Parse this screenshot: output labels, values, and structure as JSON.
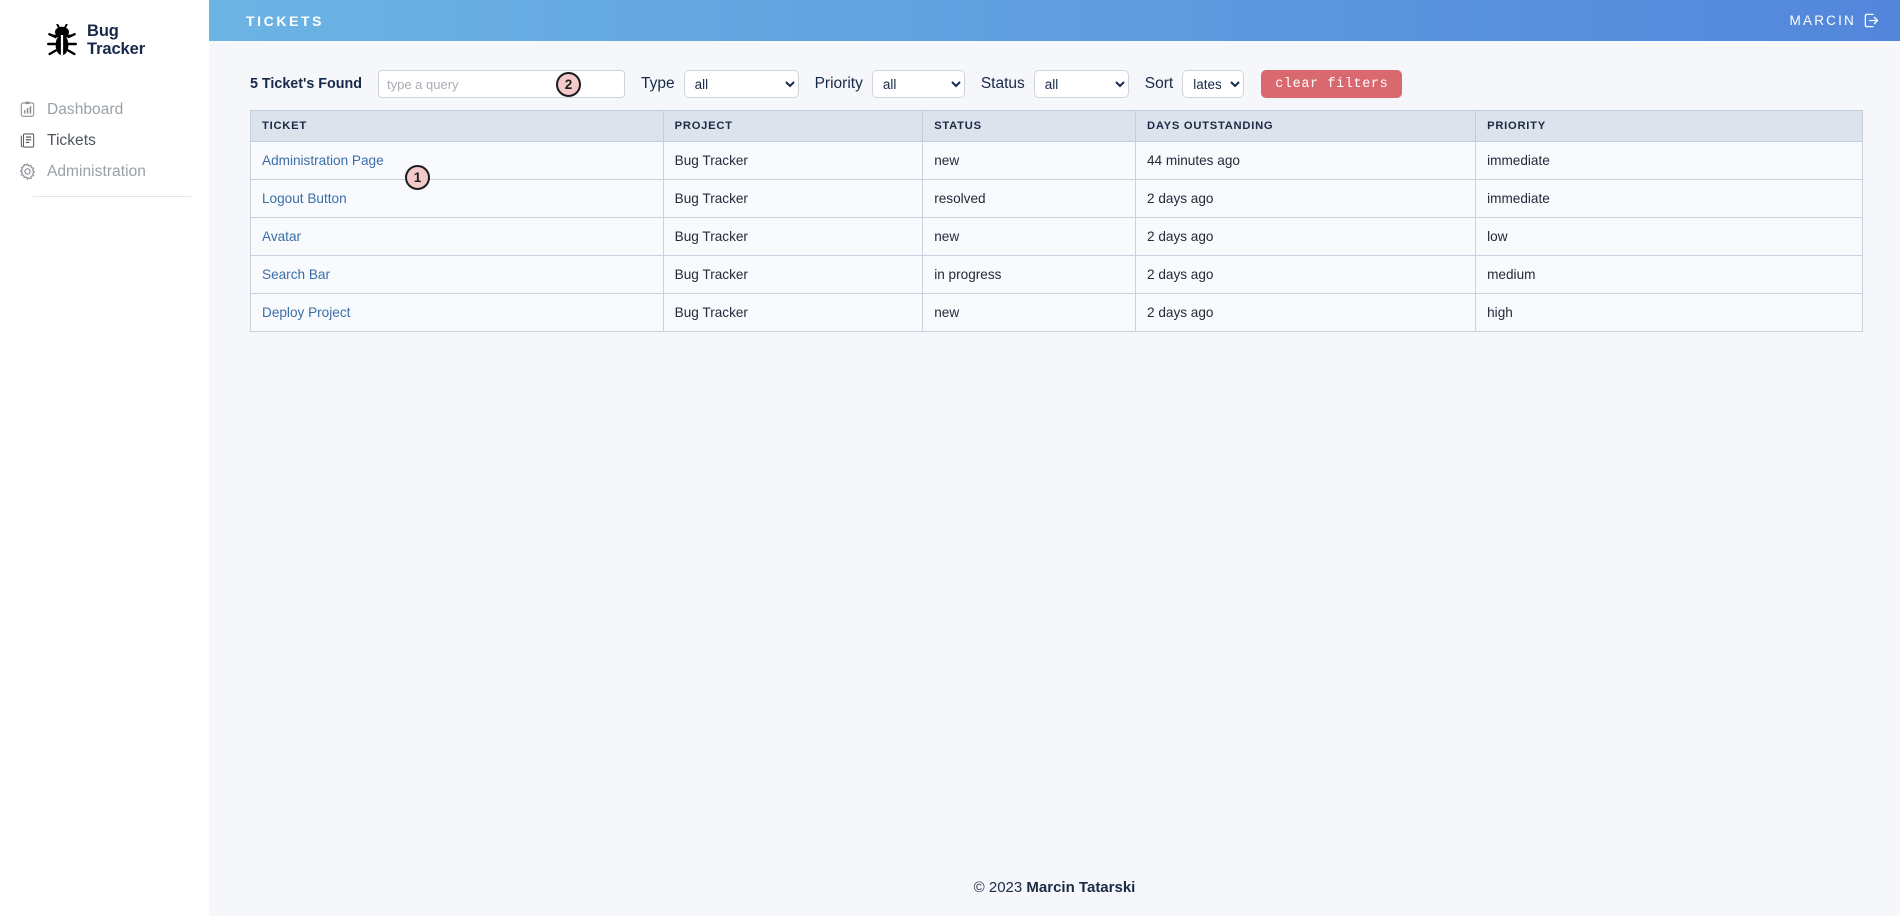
{
  "brand": {
    "line1": "Bug",
    "line2": "Tracker",
    "icon": "bug-icon"
  },
  "sidebar": {
    "items": [
      {
        "label": "Dashboard",
        "icon": "chart-clipboard-icon",
        "active": false
      },
      {
        "label": "Tickets",
        "icon": "journal-icon",
        "active": true
      },
      {
        "label": "Administration",
        "icon": "gear-icon",
        "active": false
      }
    ]
  },
  "topbar": {
    "title": "TICKETS",
    "user": "MARCIN",
    "logout_icon": "logout-icon"
  },
  "filters": {
    "found_label": "5 Ticket's Found",
    "search_placeholder": "type a query",
    "search_value": "",
    "type_label": "Type",
    "type_value": "all",
    "type_options": [
      "all"
    ],
    "priority_label": "Priority",
    "priority_value": "all",
    "priority_options": [
      "all"
    ],
    "status_label": "Status",
    "status_value": "all",
    "status_options": [
      "all"
    ],
    "sort_label": "Sort",
    "sort_value": "latest",
    "sort_options": [
      "latest"
    ],
    "clear_label": "clear filters",
    "clear_color": "#d9696f"
  },
  "table": {
    "headers": [
      "TICKET",
      "PROJECT",
      "STATUS",
      "DAYS OUTSTANDING",
      "PRIORITY"
    ],
    "rows": [
      {
        "ticket": "Administration Page",
        "project": "Bug Tracker",
        "status": "new",
        "days": "44 minutes ago",
        "priority": "immediate"
      },
      {
        "ticket": "Logout Button",
        "project": "Bug Tracker",
        "status": "resolved",
        "days": "2 days ago",
        "priority": "immediate"
      },
      {
        "ticket": "Avatar",
        "project": "Bug Tracker",
        "status": "new",
        "days": "2 days ago",
        "priority": "low"
      },
      {
        "ticket": "Search Bar",
        "project": "Bug Tracker",
        "status": "in progress",
        "days": "2 days ago",
        "priority": "medium"
      },
      {
        "ticket": "Deploy Project",
        "project": "Bug Tracker",
        "status": "new",
        "days": "2 days ago",
        "priority": "high"
      }
    ]
  },
  "footer": {
    "copyright": "© 2023 ",
    "name": "Marcin Tatarski"
  },
  "annotations": [
    {
      "id": "1",
      "target": "ticket-link-administration-page"
    },
    {
      "id": "2",
      "target": "search-input"
    }
  ],
  "colors": {
    "header_gradient_start": "#6cb4e4",
    "header_gradient_end": "#5386db",
    "accent_button": "#d9696f",
    "link": "#3a6ea8",
    "page_bg": "#f6f7fb",
    "table_head_bg": "#dde3ec"
  }
}
